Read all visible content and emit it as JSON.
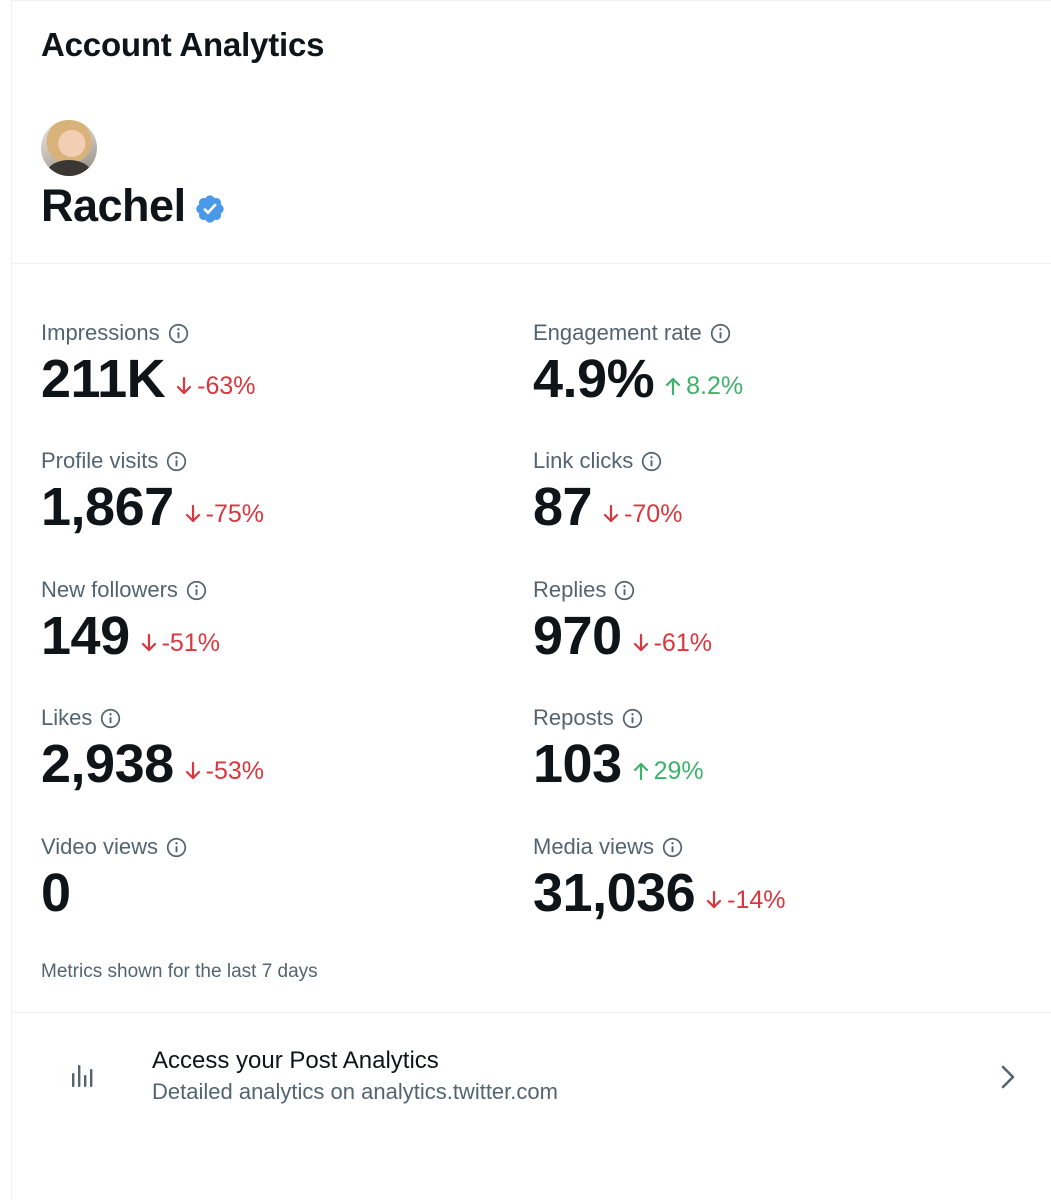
{
  "header": {
    "title": "Account Analytics"
  },
  "profile": {
    "name": "Rachel",
    "verified": true,
    "verified_color": "#4a99e9"
  },
  "colors": {
    "down": "#d9363e",
    "up": "#3db26b",
    "muted": "#536471",
    "text": "#0f1419"
  },
  "metrics": [
    {
      "label": "Impressions",
      "value": "211K",
      "change": "-63%",
      "direction": "down"
    },
    {
      "label": "Engagement rate",
      "value": "4.9%",
      "change": "8.2%",
      "direction": "up"
    },
    {
      "label": "Profile visits",
      "value": "1,867",
      "change": "-75%",
      "direction": "down"
    },
    {
      "label": "Link clicks",
      "value": "87",
      "change": "-70%",
      "direction": "down"
    },
    {
      "label": "New followers",
      "value": "149",
      "change": "-51%",
      "direction": "down"
    },
    {
      "label": "Replies",
      "value": "970",
      "change": "-61%",
      "direction": "down"
    },
    {
      "label": "Likes",
      "value": "2,938",
      "change": "-53%",
      "direction": "down"
    },
    {
      "label": "Reposts",
      "value": "103",
      "change": "29%",
      "direction": "up"
    },
    {
      "label": "Video views",
      "value": "0",
      "change": "",
      "direction": ""
    },
    {
      "label": "Media views",
      "value": "31,036",
      "change": "-14%",
      "direction": "down"
    }
  ],
  "footnote": "Metrics shown for the last 7 days",
  "post_analytics": {
    "title": "Access your Post Analytics",
    "subtitle": "Detailed analytics on analytics.twitter.com",
    "icon": "bar-chart-icon"
  }
}
